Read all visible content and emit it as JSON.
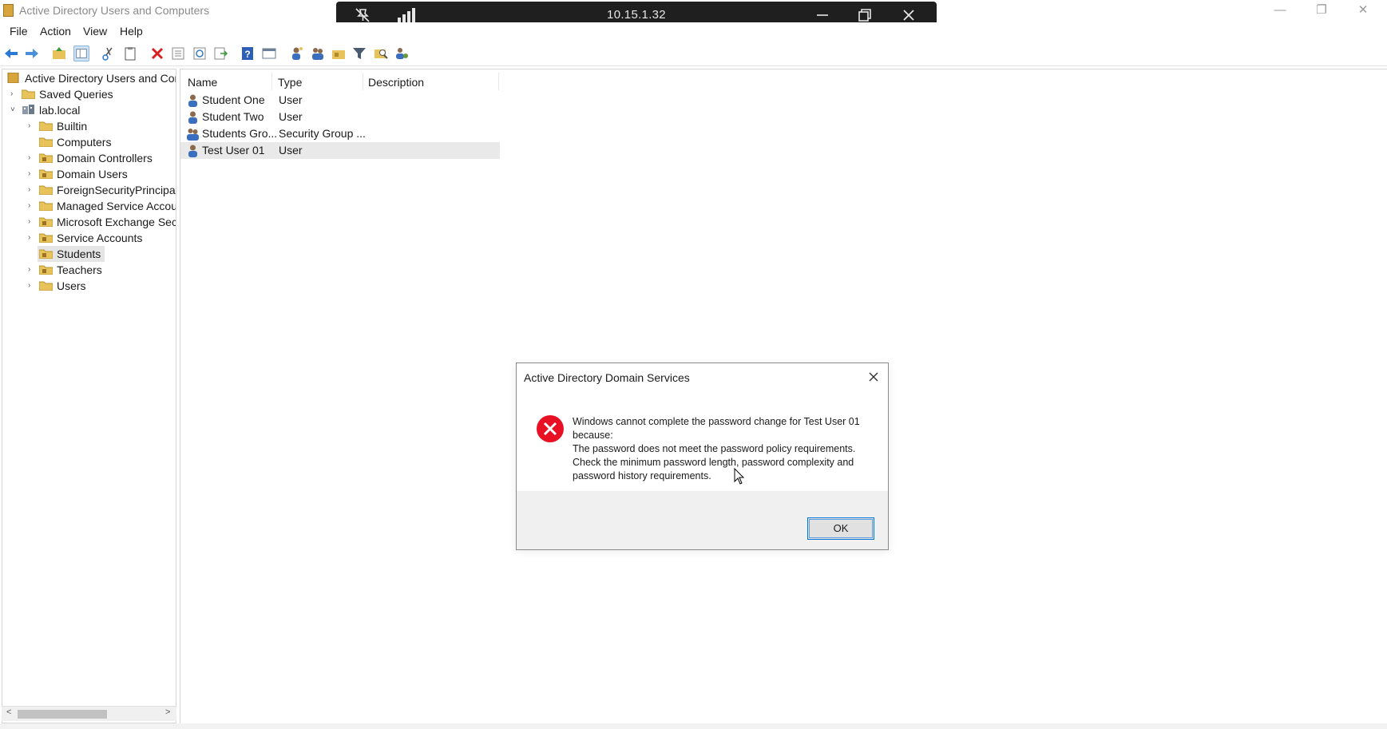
{
  "window": {
    "title": "Active Directory Users and Computers",
    "controls": {
      "minimize": "—",
      "restore": "❐",
      "close": "✕"
    }
  },
  "remote_bar": {
    "address": "10.15.1.32",
    "icons": [
      "unpin-icon",
      "signal-strength-icon",
      "minimize-icon",
      "restore-icon",
      "close-icon"
    ]
  },
  "menu": {
    "file": "File",
    "action": "Action",
    "view": "View",
    "help": "Help"
  },
  "toolbar": {
    "icons": [
      "back-arrow-icon",
      "forward-arrow-icon",
      "up-folder-icon",
      "show-tree-icon",
      "cut-icon",
      "paste-icon",
      "delete-icon",
      "properties-icon",
      "refresh-icon",
      "export-list-icon",
      "help-icon",
      "console-icon",
      "new-user-icon",
      "new-group-icon",
      "new-ou-icon",
      "filter-icon",
      "find-icon",
      "add-to-group-icon"
    ]
  },
  "tree": {
    "root": "Active Directory Users and Comp",
    "saved_queries": "Saved Queries",
    "domain": "lab.local",
    "children": [
      "Builtin",
      "Computers",
      "Domain Controllers",
      "Domain Users",
      "ForeignSecurityPrincipals",
      "Managed Service Accoun",
      "Microsoft Exchange Secu",
      "Service Accounts",
      "Students",
      "Teachers",
      "Users"
    ],
    "selected": "Students"
  },
  "list": {
    "columns": [
      "Name",
      "Type",
      "Description"
    ],
    "rows": [
      {
        "name": "Student One",
        "type": "User",
        "icon": "user-icon"
      },
      {
        "name": "Student Two",
        "type": "User",
        "icon": "user-icon"
      },
      {
        "name": "Students Gro...",
        "type": "Security Group ...",
        "icon": "group-icon"
      },
      {
        "name": "Test User 01",
        "type": "User",
        "icon": "user-icon"
      }
    ],
    "selected_row": "Test User 01"
  },
  "dialog": {
    "title": "Active Directory Domain Services",
    "lines": [
      "Windows cannot complete the password change for Test User 01",
      "because:",
      "The password does not meet the password policy requirements.",
      "Check the minimum password length, password complexity and",
      "password history requirements."
    ],
    "ok_label": "OK",
    "icon": "error-icon"
  },
  "colors": {
    "error_red": "#e81123",
    "folder_yellow": "#e8c25a",
    "accent_blue": "#0078d7"
  }
}
